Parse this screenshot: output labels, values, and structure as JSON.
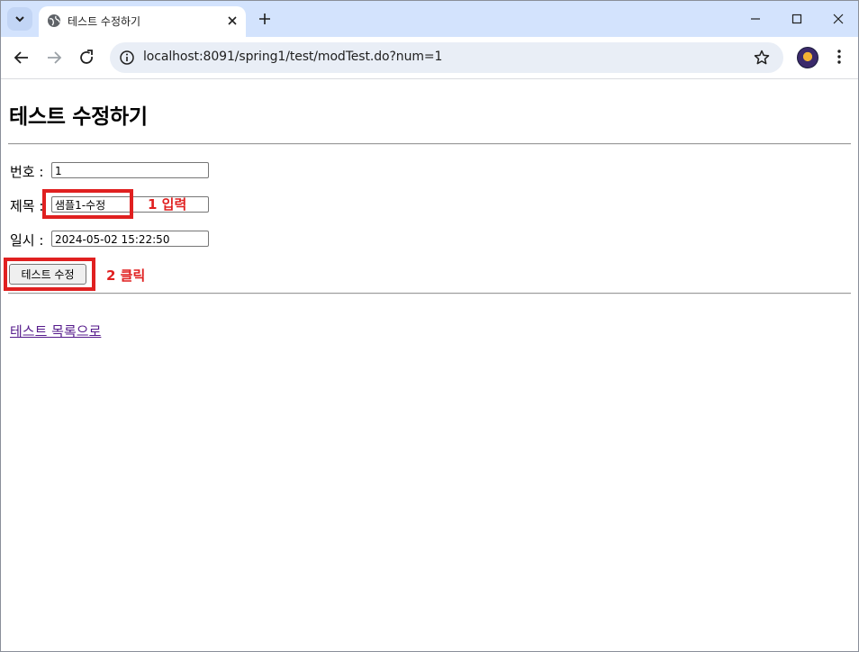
{
  "browser": {
    "tab_title": "테스트 수정하기",
    "url": "localhost:8091/spring1/test/modTest.do?num=1"
  },
  "page": {
    "heading": "테스트 수정하기",
    "form": {
      "num_label": "번호 :",
      "num_value": "1",
      "title_label": "제목 :",
      "title_value": "샘플1-수정",
      "date_label": "일시 :",
      "date_value": "2024-05-02 15:22:50",
      "submit_label": "테스트 수정"
    },
    "list_link": "테스트 목록으로"
  },
  "annotations": {
    "step1": "1 입력",
    "step2": "2 클릭",
    "color": "#e02020"
  },
  "icons": [
    "tab-search-icon",
    "globe-icon",
    "close-icon",
    "plus-icon",
    "minimize-icon",
    "maximize-icon",
    "window-close-icon",
    "back-icon",
    "forward-icon",
    "reload-icon",
    "site-info-icon",
    "bookmark-star-icon",
    "kebab-menu-icon"
  ]
}
